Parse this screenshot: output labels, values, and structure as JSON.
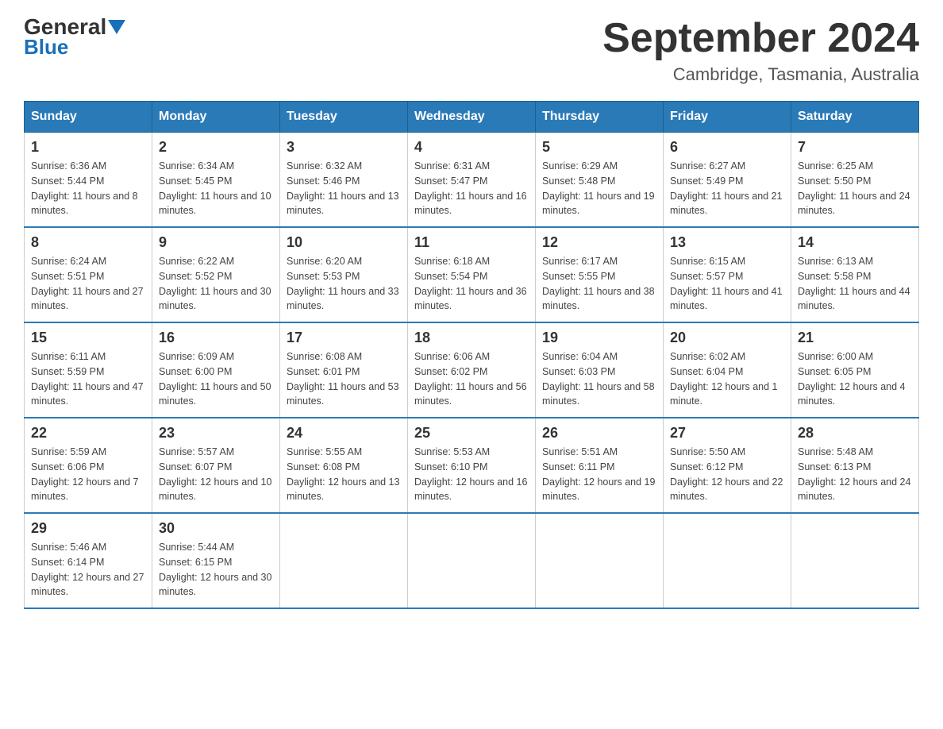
{
  "logo": {
    "general": "General",
    "blue": "Blue"
  },
  "title": "September 2024",
  "subtitle": "Cambridge, Tasmania, Australia",
  "days_header": [
    "Sunday",
    "Monday",
    "Tuesday",
    "Wednesday",
    "Thursday",
    "Friday",
    "Saturday"
  ],
  "weeks": [
    [
      {
        "day": "1",
        "sunrise": "6:36 AM",
        "sunset": "5:44 PM",
        "daylight": "11 hours and 8 minutes."
      },
      {
        "day": "2",
        "sunrise": "6:34 AM",
        "sunset": "5:45 PM",
        "daylight": "11 hours and 10 minutes."
      },
      {
        "day": "3",
        "sunrise": "6:32 AM",
        "sunset": "5:46 PM",
        "daylight": "11 hours and 13 minutes."
      },
      {
        "day": "4",
        "sunrise": "6:31 AM",
        "sunset": "5:47 PM",
        "daylight": "11 hours and 16 minutes."
      },
      {
        "day": "5",
        "sunrise": "6:29 AM",
        "sunset": "5:48 PM",
        "daylight": "11 hours and 19 minutes."
      },
      {
        "day": "6",
        "sunrise": "6:27 AM",
        "sunset": "5:49 PM",
        "daylight": "11 hours and 21 minutes."
      },
      {
        "day": "7",
        "sunrise": "6:25 AM",
        "sunset": "5:50 PM",
        "daylight": "11 hours and 24 minutes."
      }
    ],
    [
      {
        "day": "8",
        "sunrise": "6:24 AM",
        "sunset": "5:51 PM",
        "daylight": "11 hours and 27 minutes."
      },
      {
        "day": "9",
        "sunrise": "6:22 AM",
        "sunset": "5:52 PM",
        "daylight": "11 hours and 30 minutes."
      },
      {
        "day": "10",
        "sunrise": "6:20 AM",
        "sunset": "5:53 PM",
        "daylight": "11 hours and 33 minutes."
      },
      {
        "day": "11",
        "sunrise": "6:18 AM",
        "sunset": "5:54 PM",
        "daylight": "11 hours and 36 minutes."
      },
      {
        "day": "12",
        "sunrise": "6:17 AM",
        "sunset": "5:55 PM",
        "daylight": "11 hours and 38 minutes."
      },
      {
        "day": "13",
        "sunrise": "6:15 AM",
        "sunset": "5:57 PM",
        "daylight": "11 hours and 41 minutes."
      },
      {
        "day": "14",
        "sunrise": "6:13 AM",
        "sunset": "5:58 PM",
        "daylight": "11 hours and 44 minutes."
      }
    ],
    [
      {
        "day": "15",
        "sunrise": "6:11 AM",
        "sunset": "5:59 PM",
        "daylight": "11 hours and 47 minutes."
      },
      {
        "day": "16",
        "sunrise": "6:09 AM",
        "sunset": "6:00 PM",
        "daylight": "11 hours and 50 minutes."
      },
      {
        "day": "17",
        "sunrise": "6:08 AM",
        "sunset": "6:01 PM",
        "daylight": "11 hours and 53 minutes."
      },
      {
        "day": "18",
        "sunrise": "6:06 AM",
        "sunset": "6:02 PM",
        "daylight": "11 hours and 56 minutes."
      },
      {
        "day": "19",
        "sunrise": "6:04 AM",
        "sunset": "6:03 PM",
        "daylight": "11 hours and 58 minutes."
      },
      {
        "day": "20",
        "sunrise": "6:02 AM",
        "sunset": "6:04 PM",
        "daylight": "12 hours and 1 minute."
      },
      {
        "day": "21",
        "sunrise": "6:00 AM",
        "sunset": "6:05 PM",
        "daylight": "12 hours and 4 minutes."
      }
    ],
    [
      {
        "day": "22",
        "sunrise": "5:59 AM",
        "sunset": "6:06 PM",
        "daylight": "12 hours and 7 minutes."
      },
      {
        "day": "23",
        "sunrise": "5:57 AM",
        "sunset": "6:07 PM",
        "daylight": "12 hours and 10 minutes."
      },
      {
        "day": "24",
        "sunrise": "5:55 AM",
        "sunset": "6:08 PM",
        "daylight": "12 hours and 13 minutes."
      },
      {
        "day": "25",
        "sunrise": "5:53 AM",
        "sunset": "6:10 PM",
        "daylight": "12 hours and 16 minutes."
      },
      {
        "day": "26",
        "sunrise": "5:51 AM",
        "sunset": "6:11 PM",
        "daylight": "12 hours and 19 minutes."
      },
      {
        "day": "27",
        "sunrise": "5:50 AM",
        "sunset": "6:12 PM",
        "daylight": "12 hours and 22 minutes."
      },
      {
        "day": "28",
        "sunrise": "5:48 AM",
        "sunset": "6:13 PM",
        "daylight": "12 hours and 24 minutes."
      }
    ],
    [
      {
        "day": "29",
        "sunrise": "5:46 AM",
        "sunset": "6:14 PM",
        "daylight": "12 hours and 27 minutes."
      },
      {
        "day": "30",
        "sunrise": "5:44 AM",
        "sunset": "6:15 PM",
        "daylight": "12 hours and 30 minutes."
      },
      null,
      null,
      null,
      null,
      null
    ]
  ]
}
